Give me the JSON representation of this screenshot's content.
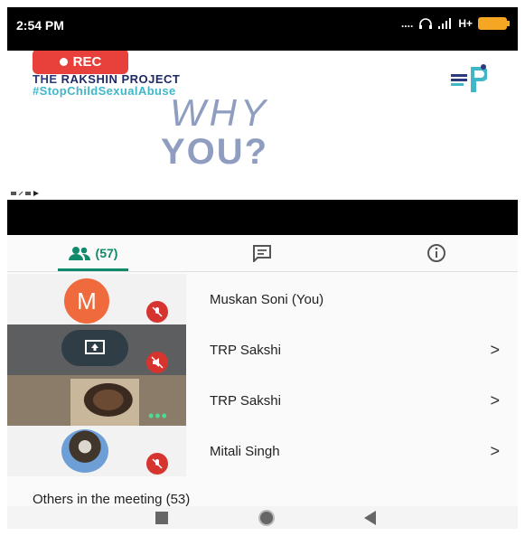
{
  "status_bar": {
    "time": "2:54 PM",
    "signal_text": "....",
    "network_text": "H+"
  },
  "video": {
    "rec_label": "REC",
    "project_prefix": "THE",
    "project_name": "RAKSHIN PROJECT",
    "hashtag": "#StopChildSexualAbuse",
    "headline_1": "WHY",
    "headline_2": "YOU?"
  },
  "tabs": {
    "people_count": "(57)",
    "people_icon": "people-icon",
    "chat_icon": "chat-icon",
    "info_icon": "info-icon"
  },
  "participants": [
    {
      "name": "Muskan Soni (You)",
      "avatar_letter": "M",
      "muted": true
    },
    {
      "name": "TRP Sakshi",
      "muted": true,
      "chevron": ">"
    },
    {
      "name": "TRP Sakshi",
      "chevron": ">"
    },
    {
      "name": "Mitali Singh",
      "muted": true,
      "chevron": ">"
    }
  ],
  "others_label": "Others in the meeting (53)",
  "colors": {
    "accent": "#0f8a6a",
    "rec": "#e8413b",
    "mute": "#d6342f"
  }
}
